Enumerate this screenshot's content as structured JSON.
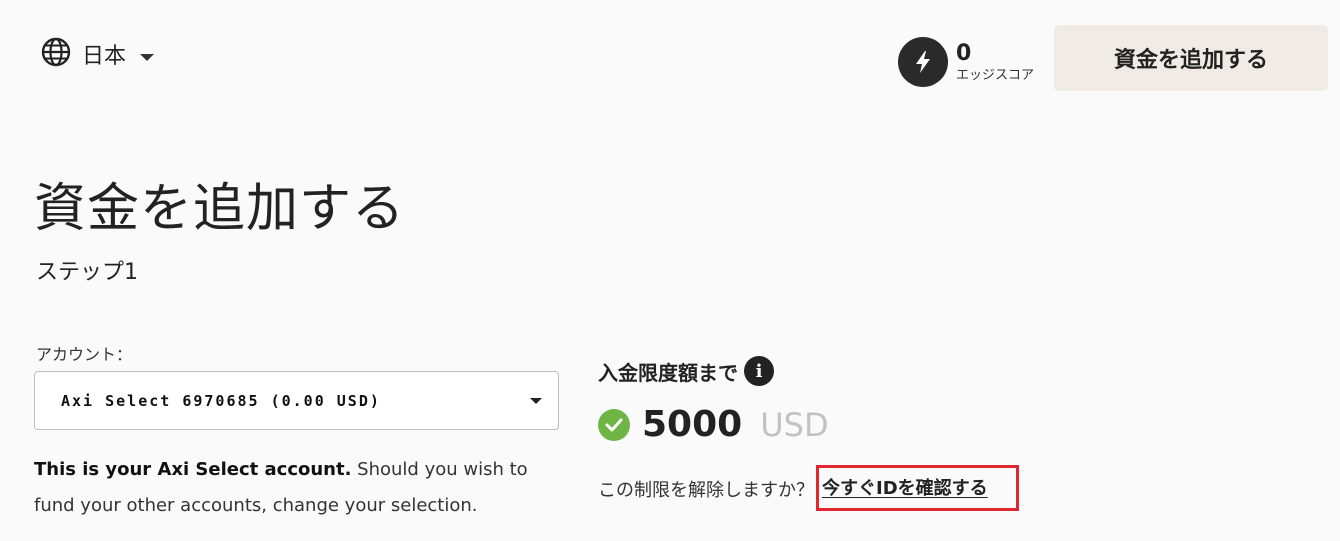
{
  "header": {
    "language_label": "日本",
    "edge_score_value": "0",
    "edge_score_label": "エッジスコア",
    "add_funds_button": "資金を追加する"
  },
  "main": {
    "title": "資金を追加する",
    "step": "ステップ1",
    "account": {
      "label": "アカウント：",
      "selected": "Axi Select 6970685 (0.00 USD)",
      "help_bold": "This is your Axi Select account.",
      "help_rest": " Should you wish to fund your other accounts, change your selection."
    },
    "deposit_limit": {
      "title": "入金限度額まで",
      "amount": "5000",
      "currency": "USD",
      "remove_question": "この制限を解除しますか？",
      "verify_link": "今すぐIDを確認する"
    }
  },
  "colors": {
    "background": "#fafafa",
    "button_bg": "#f0ebe4",
    "check_green": "#6fb545",
    "highlight_red": "#e0262e"
  }
}
